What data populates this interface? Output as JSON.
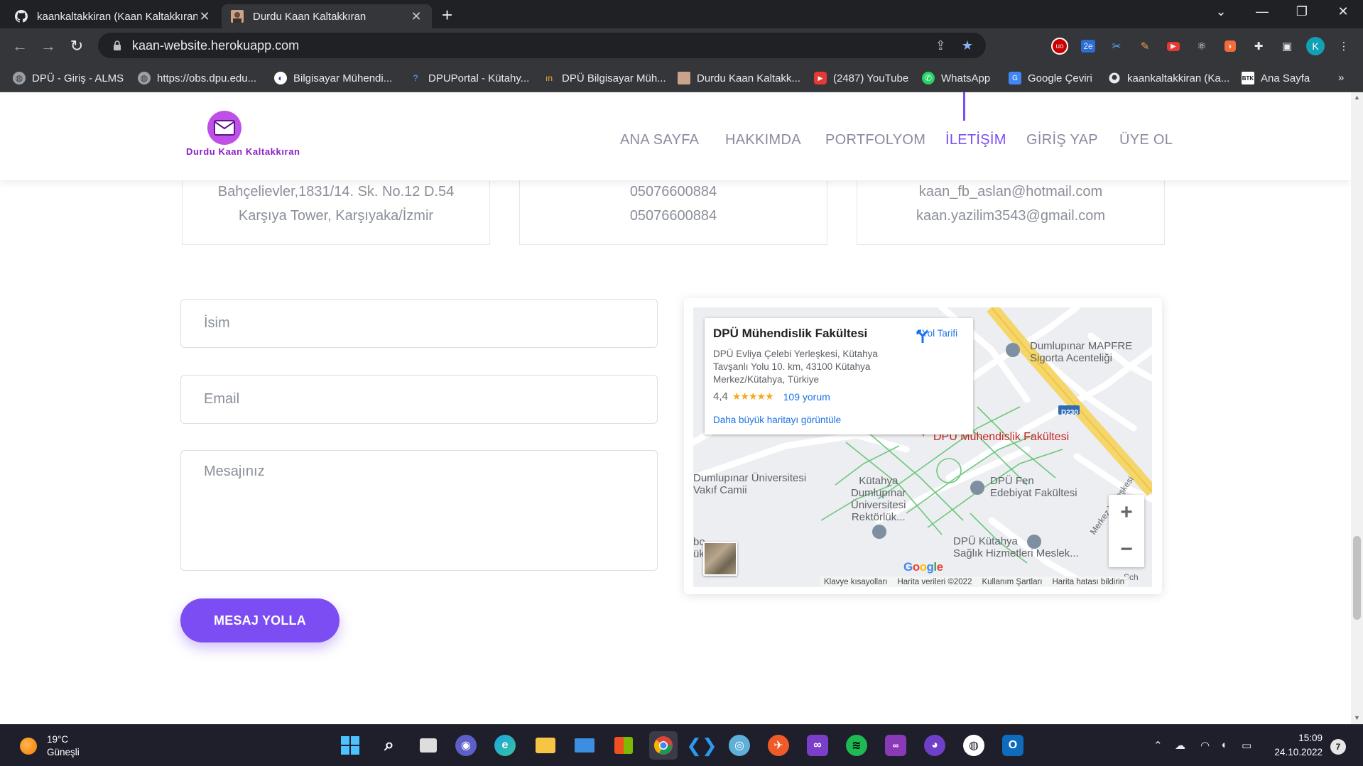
{
  "browser": {
    "tabs": [
      {
        "title": "kaankaltakkiran (Kaan Kaltakkıran)",
        "active": false
      },
      {
        "title": "Durdu Kaan Kaltakkıran",
        "active": true
      }
    ],
    "url": "kaan-website.herokuapp.com",
    "profile_initial": "K",
    "bookmarks": [
      "DPÜ - Giriş - ALMS",
      "https://obs.dpu.edu...",
      "Bilgisayar Mühendi...",
      "DPUPortal - Kütahy...",
      "DPÜ Bilgisayar Müh...",
      "Durdu Kaan Kaltakk...",
      "(2487) YouTube",
      "WhatsApp",
      "Google Çeviri",
      "kaankaltakkiran (Ka...",
      "Ana Sayfa"
    ],
    "bookmark_overflow": "»"
  },
  "site": {
    "logo_text": "Durdu Kaan Kaltakkıran",
    "menu": [
      "ANA SAYFA",
      "HAKKIMDA",
      "PORTFOLYOM",
      "İLETİŞİM",
      "GİRİŞ YAP",
      "ÜYE OL"
    ],
    "active_menu": "İLETİŞİM",
    "info": {
      "address": [
        "Bahçelievler,1831/14. Sk. No.12 D.54",
        "Karşıya Tower, Karşıyaka/İzmir"
      ],
      "phones": [
        "05076600884",
        "05076600884"
      ],
      "emails": [
        "kaan_fb_aslan@hotmail.com",
        "kaan.yazilim3543@gmail.com"
      ]
    },
    "form": {
      "name_placeholder": "İsim",
      "email_placeholder": "Email",
      "message_placeholder": "Mesajınız",
      "submit_label": "MESAJ YOLLA"
    },
    "map": {
      "place_title": "DPÜ Mühendislik Fakültesi",
      "address": "DPÜ Evliya Çelebi Yerleşkesi, Kütahya Tavşanlı Yolu 10. km, 43100 Kütahya Merkez/Kütahya, Türkiye",
      "rating": "4,4",
      "stars": "★★★★★",
      "reviews": "109 yorum",
      "directions": "Yol Tarifi",
      "bigger_map": "Daha büyük haritayı görüntüle",
      "labels": {
        "mapfre": "Dumlupınar MAPFRE\nSigorta Acenteliği",
        "muhendislik": "DPÜ Mühendislik Fakültesi",
        "univ_mosque": "Dumlupınar Üniversitesi\nVakıf Camii",
        "rektorluk": "Kütahya\nDumlupınar\nÜniversitesi\nRektörlük...",
        "fen_edebiyat": "DPÜ Fen\nEdebiyat Fakültesi",
        "meslek": "DPÜ Kütahya\nSağlık Hizmetleri Meslek...",
        "road": "D230",
        "yerleske": "Merkez Yerleşkesi",
        "left_cut": "bo\nükulu",
        "sch": "Sch"
      },
      "zoom_in": "+",
      "zoom_out": "−",
      "footer": [
        "Klavye kısayolları",
        "Harita verileri ©2022",
        "Kullanım Şartları",
        "Harita hatası bildirin"
      ],
      "watermark": "Google"
    }
  },
  "taskbar": {
    "temperature": "19°C",
    "condition": "Güneşli",
    "time": "15:09",
    "date": "24.10.2022",
    "notifications": "7"
  }
}
